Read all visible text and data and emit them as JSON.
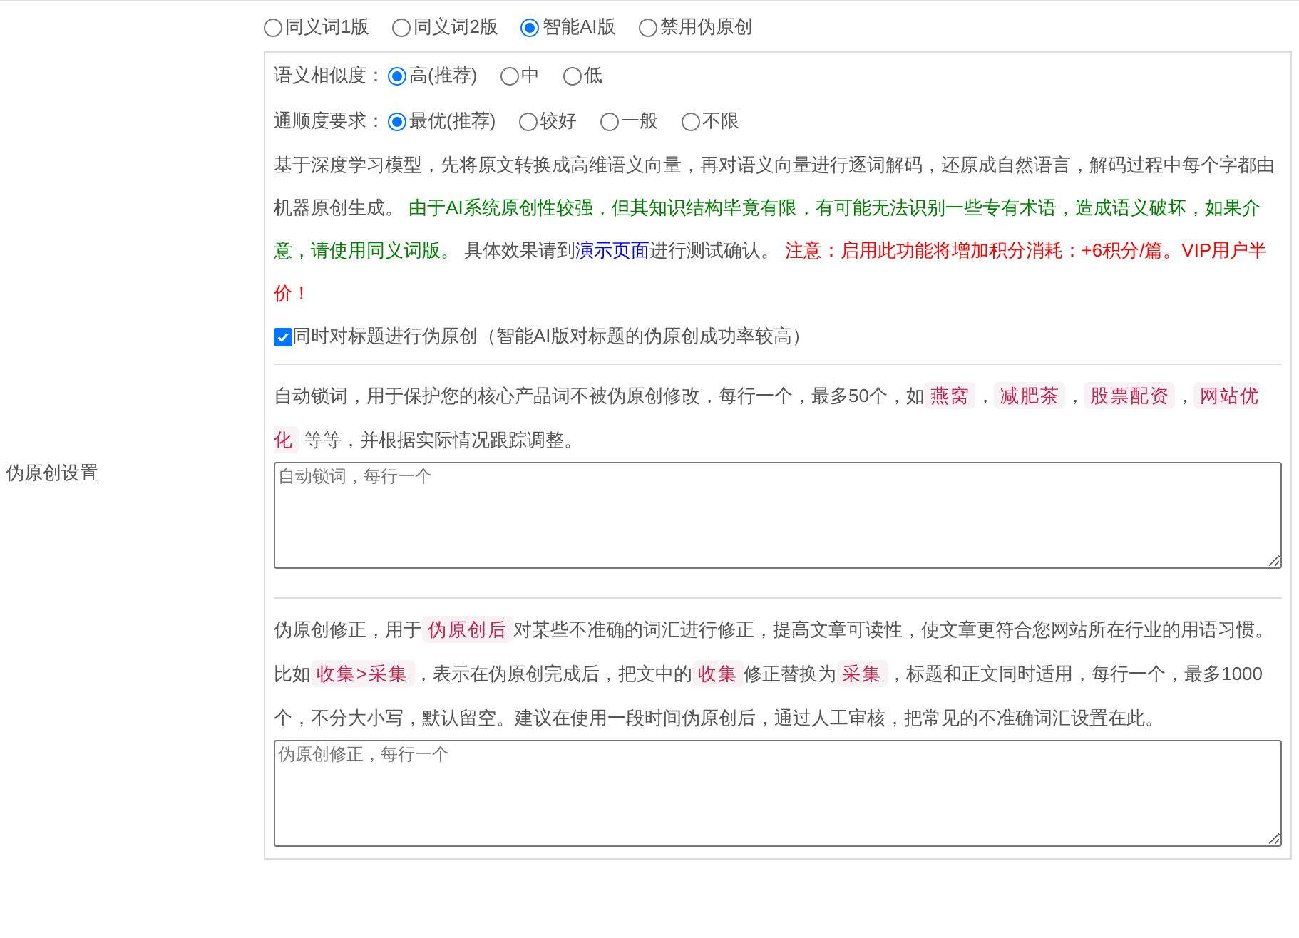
{
  "section_label": "伪原创设置",
  "modes": [
    {
      "label": "同义词1版",
      "selected": false
    },
    {
      "label": "同义词2版",
      "selected": false
    },
    {
      "label": "智能AI版",
      "selected": true
    },
    {
      "label": "禁用伪原创",
      "selected": false
    }
  ],
  "settings": [
    {
      "label": "语义相似度：",
      "options": [
        {
          "label": "高(推荐)",
          "selected": true
        },
        {
          "label": "中",
          "selected": false
        },
        {
          "label": "低",
          "selected": false
        }
      ]
    },
    {
      "label": "通顺度要求：",
      "options": [
        {
          "label": "最优(推荐)",
          "selected": true
        },
        {
          "label": "较好",
          "selected": false
        },
        {
          "label": "一般",
          "selected": false
        },
        {
          "label": "不限",
          "selected": false
        }
      ]
    }
  ],
  "ai_description": [
    {
      "kind": "plain",
      "text": "基于深度学习模型，先将原文转换成高维语义向量，再对语义向量进行逐词解码，还原成自然语言，解码过程中每个字都由机器原创生成。 "
    },
    {
      "kind": "green",
      "text": "由于AI系统原创性较强，但其知识结构毕竟有限，有可能无法识别一些专有术语，造成语义破坏，如果介意，请使用同义词版。 "
    },
    {
      "kind": "plain",
      "text": "具体效果请到"
    },
    {
      "kind": "link",
      "text": "演示页面"
    },
    {
      "kind": "plain",
      "text": "进行测试确认。 "
    },
    {
      "kind": "red",
      "text": "注意：启用此功能将增加积分消耗：+6积分/篇。VIP用户半价！"
    }
  ],
  "title_option": {
    "label": "同时对标题进行伪原创（智能AI版对标题的伪原创成功率较高）",
    "checked": true
  },
  "lock_words": {
    "description": [
      {
        "kind": "plain",
        "text": "自动锁词，用于保护您的核心产品词不被伪原创修改，每行一个，最多50个，如"
      },
      {
        "kind": "code",
        "text": "燕窝"
      },
      {
        "kind": "plain",
        "text": "，"
      },
      {
        "kind": "code",
        "text": "减肥茶"
      },
      {
        "kind": "plain",
        "text": "，"
      },
      {
        "kind": "code",
        "text": "股票配资"
      },
      {
        "kind": "plain",
        "text": "，"
      },
      {
        "kind": "code",
        "text": "网站优化"
      },
      {
        "kind": "plain",
        "text": " 等等，并根据实际情况跟踪调整。"
      }
    ],
    "placeholder": "自动锁词，每行一个"
  },
  "corrections": {
    "description": [
      {
        "kind": "plain",
        "text": "伪原创修正，用于"
      },
      {
        "kind": "code",
        "text": "伪原创后"
      },
      {
        "kind": "plain",
        "text": "对某些不准确的词汇进行修正，提高文章可读性，使文章更符合您网站所在行业的用语习惯。比如"
      },
      {
        "kind": "code",
        "text": "收集>采集"
      },
      {
        "kind": "plain",
        "text": "，表示在伪原创完成后，把文中的"
      },
      {
        "kind": "code",
        "text": "收集"
      },
      {
        "kind": "plain",
        "text": "修正替换为"
      },
      {
        "kind": "code",
        "text": "采集"
      },
      {
        "kind": "plain",
        "text": "，标题和正文同时适用，每行一个，最多1000个，不分大小写，默认留空。建议在使用一段时间伪原创后，通过人工审核，把常见的不准确词汇设置在此。"
      }
    ],
    "placeholder": "伪原创修正，每行一个"
  }
}
